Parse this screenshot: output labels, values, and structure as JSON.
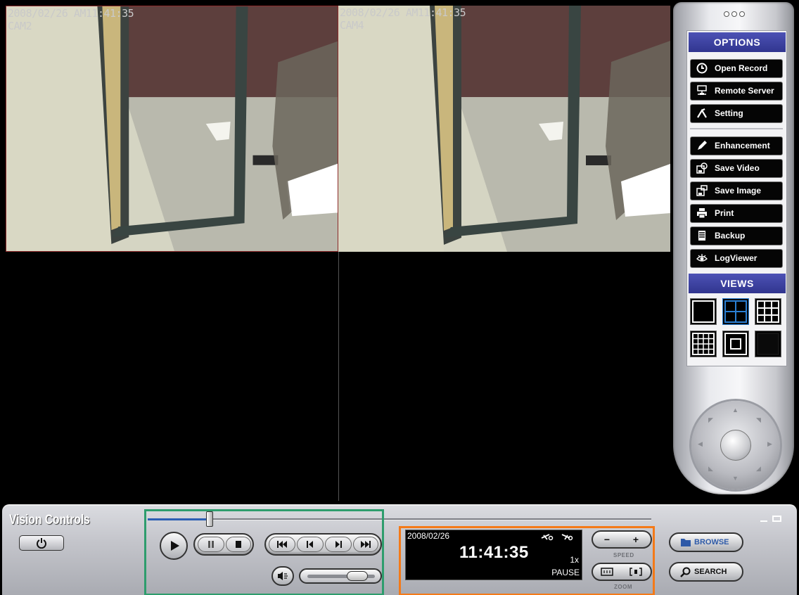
{
  "cameras": [
    {
      "timestamp": "2008/02/26 AM11:41:35",
      "label": "CAM2",
      "selected": true
    },
    {
      "timestamp": "2008/02/26 AM11:41:35",
      "label": "CAM4",
      "selected": false
    },
    {
      "timestamp": "",
      "label": "",
      "selected": false
    },
    {
      "timestamp": "",
      "label": "",
      "selected": false
    }
  ],
  "options_panel": {
    "options_header": "OPTIONS",
    "items": [
      {
        "label": "Open Record",
        "icon": "clock-icon"
      },
      {
        "label": "Remote Server",
        "icon": "network-icon"
      },
      {
        "label": "Setting",
        "icon": "tools-icon"
      },
      {
        "label": "Enhancement",
        "icon": "pencil-icon"
      },
      {
        "label": "Save Video",
        "icon": "save-video-icon"
      },
      {
        "label": "Save  Image",
        "icon": "save-image-icon"
      },
      {
        "label": "Print",
        "icon": "printer-icon"
      },
      {
        "label": "Backup",
        "icon": "backup-icon"
      },
      {
        "label": "LogViewer",
        "icon": "eye-icon"
      }
    ],
    "views_header": "VIEWS",
    "views": [
      "single-view",
      "quad-view",
      "nine-view",
      "sixteen-view",
      "picture-in-picture-view",
      "blank-view"
    ],
    "active_view": "quad-view"
  },
  "control_bar": {
    "brand": "Vision Controls",
    "timeline_progress": 0.13
  },
  "status_display": {
    "date": "2008/02/26",
    "time": "11:41:35",
    "speed": "1x",
    "state": "PAUSE"
  },
  "speed_control": {
    "label": "SPEED",
    "minus": "−",
    "plus": "+"
  },
  "zoom_control": {
    "label": "ZOOM"
  },
  "buttons": {
    "browse": "BROWSE",
    "search": "SEARCH"
  },
  "volume": {
    "level": 0.82
  },
  "colors": {
    "header_blue": "#3f44a8",
    "selected_cam_border": "#8c2a2a",
    "playback_group_outline": "#2e9d6d",
    "transport_group_outline": "#f47a18",
    "active_view_blue": "#2a7fd4"
  }
}
